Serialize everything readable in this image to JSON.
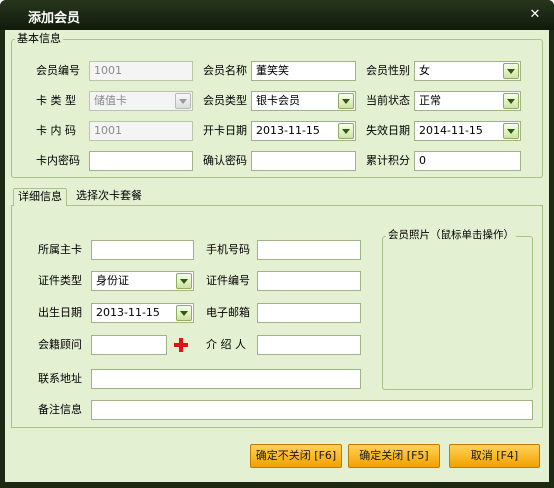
{
  "window": {
    "title": "添加会员",
    "close_glyph": "✕"
  },
  "basic": {
    "group_title": "基本信息",
    "member_no": {
      "label": "会员编号",
      "value": "1001"
    },
    "member_name": {
      "label": "会员名称",
      "value": "董笑笑"
    },
    "gender": {
      "label": "会员性别",
      "value": "女"
    },
    "card_type": {
      "label": "卡 类 型",
      "value": "储值卡"
    },
    "member_type": {
      "label": "会员类型",
      "value": "银卡会员"
    },
    "status": {
      "label": "当前状态",
      "value": "正常"
    },
    "card_code": {
      "label": "卡 内 码",
      "value": "1001"
    },
    "open_date": {
      "label": "开卡日期",
      "value": "2013-11-15"
    },
    "expire_date": {
      "label": "失效日期",
      "value": "2014-11-15"
    },
    "card_password": {
      "label": "卡内密码",
      "value": ""
    },
    "confirm_password": {
      "label": "确认密码",
      "value": ""
    },
    "points": {
      "label": "累计积分",
      "value": "0"
    }
  },
  "tabs": [
    {
      "label": "详细信息",
      "active": true
    },
    {
      "label": "选择次卡套餐",
      "active": false
    }
  ],
  "detail": {
    "main_card": {
      "label": "所属主卡",
      "value": ""
    },
    "phone": {
      "label": "手机号码",
      "value": ""
    },
    "id_type": {
      "label": "证件类型",
      "value": "身份证"
    },
    "id_no": {
      "label": "证件编号",
      "value": ""
    },
    "birthday": {
      "label": "出生日期",
      "value": "2013-11-15"
    },
    "email": {
      "label": "电子邮箱",
      "value": ""
    },
    "consultant": {
      "label": "会籍顾问",
      "value": ""
    },
    "referrer": {
      "label": "介 绍 人",
      "value": ""
    },
    "address": {
      "label": "联系地址",
      "value": ""
    },
    "remark": {
      "label": "备注信息",
      "value": ""
    },
    "photo_title": "会员照片（鼠标单击操作）"
  },
  "buttons": {
    "save_keep": "确定不关闭 [F6]",
    "save_close": "确定关闭 [F5]",
    "cancel": "取消 [F4]"
  },
  "colors": {
    "title_bar": "#1c2a14",
    "panel_bg": "#e4f0d2",
    "button_orange": "#f7b324",
    "add_icon_red": "#e01414"
  },
  "icons": {
    "dropdown": "chevron-down-icon",
    "add": "plus-icon",
    "close": "close-icon"
  }
}
